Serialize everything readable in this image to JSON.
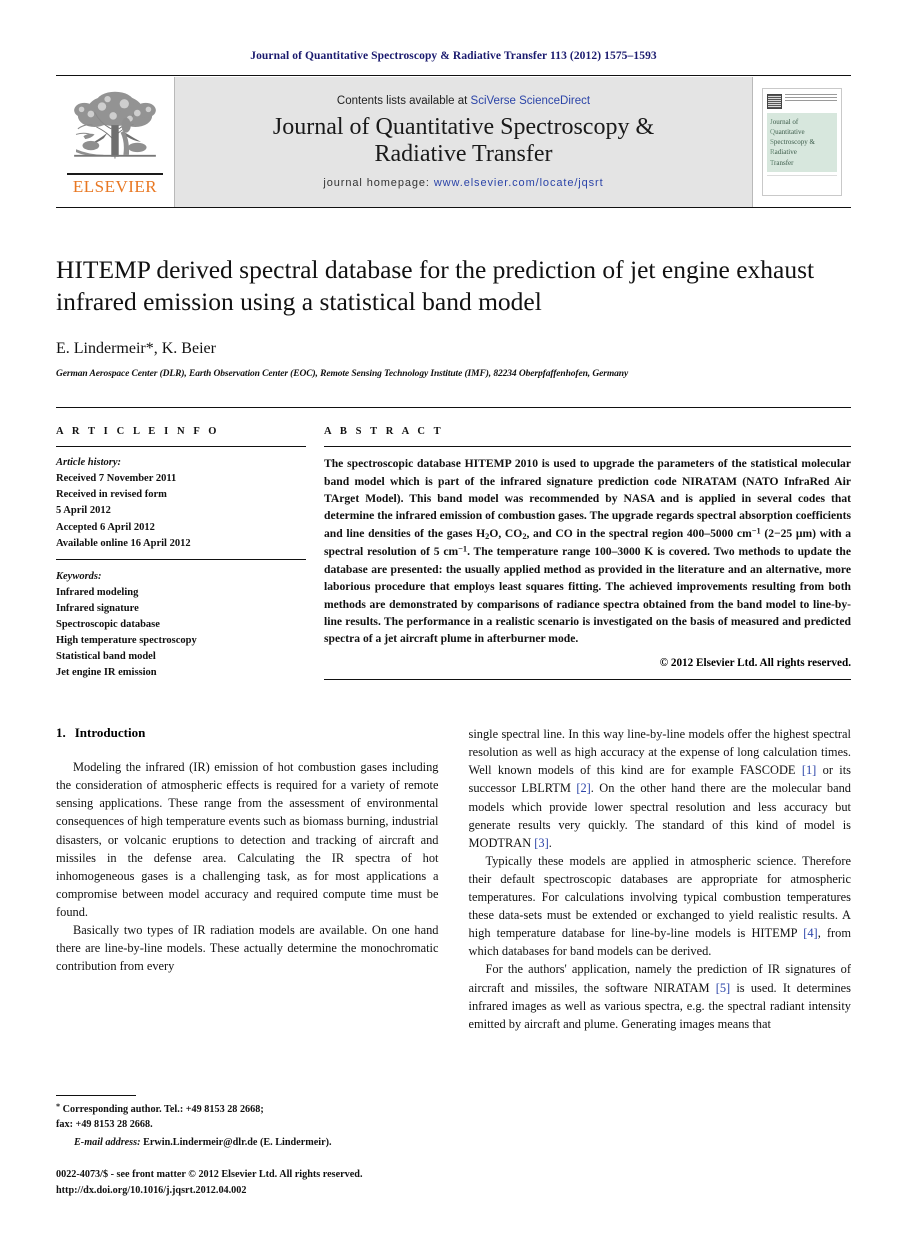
{
  "running_head": "Journal of Quantitative Spectroscopy & Radiative Transfer 113 (2012) 1575–1593",
  "masthead": {
    "contents_prefix": "Contents lists available at ",
    "sciencedirect": "SciVerse ScienceDirect",
    "journal_title_line1": "Journal of Quantitative Spectroscopy &",
    "journal_title_line2": "Radiative Transfer",
    "homepage_label": "journal homepage: ",
    "homepage_url": "www.elsevier.com/locate/jqsrt",
    "publisher_wordmark": "ELSEVIER",
    "cover_text": "ournal of uantitative pectroscopy & adiative ransfer",
    "cover_lines": [
      "ournal of",
      "uantitative",
      "pectroscopy &",
      "adiative",
      "ransfer"
    ],
    "cover_initials": [
      "J",
      "Q",
      "S",
      "R",
      "T"
    ]
  },
  "article": {
    "title": "HITEMP derived spectral database for the prediction of jet engine exhaust infrared emission using a statistical band model",
    "authors": "E. Lindermeir*, K. Beier",
    "affiliation": "German Aerospace Center (DLR), Earth Observation Center (EOC), Remote Sensing Technology Institute (IMF), 82234 Oberpfaffenhofen, Germany"
  },
  "info": {
    "heading": "A R T I C L E   I N F O",
    "history_label": "Article history:",
    "history": [
      "Received 7 November 2011",
      "Received in revised form",
      "5 April 2012",
      "Accepted 6 April 2012",
      "Available online 16 April 2012"
    ],
    "keywords_label": "Keywords:",
    "keywords": [
      "Infrared modeling",
      "Infrared signature",
      "Spectroscopic database",
      "High temperature spectroscopy",
      "Statistical band model",
      "Jet engine IR emission"
    ]
  },
  "abstract": {
    "heading": "A B S T R A C T",
    "part1": "The spectroscopic database HITEMP 2010 is used to upgrade the parameters of the statistical molecular band model which is part of the infrared signature prediction code NIRATAM (NATO InfraRed Air TArget Model). This band model was recommended by NASA and is applied in several codes that determine the infrared emission of combustion gases. The upgrade regards spectral absorption coefficients and line densities of the gases H",
    "sub1": "2",
    "part2": "O, CO",
    "sub2": "2",
    "part3": ", and CO in the spectral region 400–5000 cm",
    "sup1": "−1",
    "part4": " (2−25 μm) with a spectral resolution of 5 cm",
    "sup2": "−1",
    "part5": ". The temperature range 100–3000 K is covered. Two methods to update the database are presented: the usually applied method as provided in the literature and an alternative, more laborious procedure that employs least squares fitting. The achieved improvements resulting from both methods are demonstrated by comparisons of radiance spectra obtained from the band model to line-by-line results. The performance in a realistic scenario is investigated on the basis of measured and predicted spectra of a jet aircraft plume in afterburner mode.",
    "copyright": "© 2012 Elsevier Ltd. All rights reserved."
  },
  "section": {
    "number": "1.",
    "heading": "Introduction"
  },
  "body": {
    "left_p1": "Modeling the infrared (IR) emission of hot combustion gases including the consideration of atmospheric effects is required for a variety of remote sensing applications. These range from the assessment of environmental consequences of high temperature events such as biomass burning, industrial disasters, or volcanic eruptions to detection and tracking of aircraft and missiles in the defense area. Calculating the IR spectra of hot inhomogeneous gases is a challenging task, as for most applications a compromise between model accuracy and required compute time must be found.",
    "left_p2": "Basically two types of IR radiation models are available. On one hand there are line-by-line models. These actually determine the monochromatic contribution from every",
    "right_p1_a": "single spectral line. In this way line-by-line models offer the highest spectral resolution as well as high accuracy at the expense of long calculation times. Well known models of this kind are for example FASCODE ",
    "right_ref1": "[1]",
    "right_p1_b": " or its successor LBLRTM ",
    "right_ref2": "[2]",
    "right_p1_c": ". On the other hand there are the molecular band models which provide lower spectral resolution and less accuracy but generate results very quickly. The standard of this kind of model is MODTRAN ",
    "right_ref3": "[3]",
    "right_p1_d": ".",
    "right_p2": "Typically these models are applied in atmospheric science. Therefore their default spectroscopic databases are appropriate for atmospheric temperatures. For calculations involving typical combustion temperatures these data-sets must be extended or exchanged to yield realistic results. A high temperature database for line-by-line models is HITEMP ",
    "right_ref4": "[4]",
    "right_p2_b": ", from which databases for band models can be derived.",
    "right_p3_a": "For the authors' application, namely the prediction of IR signatures of aircraft and missiles, the software NIRATAM ",
    "right_ref5": "[5]",
    "right_p3_b": " is used. It determines infrared images as well as various spectra, e.g. the spectral radiant intensity emitted by aircraft and plume. Generating images means that"
  },
  "footnote": {
    "corresponding": "Corresponding author. Tel.: +49 8153 28 2668;",
    "fax": "fax: +49 8153 28 2668.",
    "email_label": "E-mail address:",
    "email": "Erwin.Lindermeir@dlr.de (E. Lindermeir)."
  },
  "colophon": {
    "issn_line": "0022-4073/$ - see front matter © 2012 Elsevier Ltd. All rights reserved.",
    "doi_line": "http://dx.doi.org/10.1016/j.jqsrt.2012.04.002"
  },
  "colors": {
    "runhead": "#1a1a6e",
    "link": "#2b44a8",
    "elsevier_orange": "#e87722",
    "masthead_bg": "#e4e4e4",
    "cover_green": "#d7e7dd"
  }
}
